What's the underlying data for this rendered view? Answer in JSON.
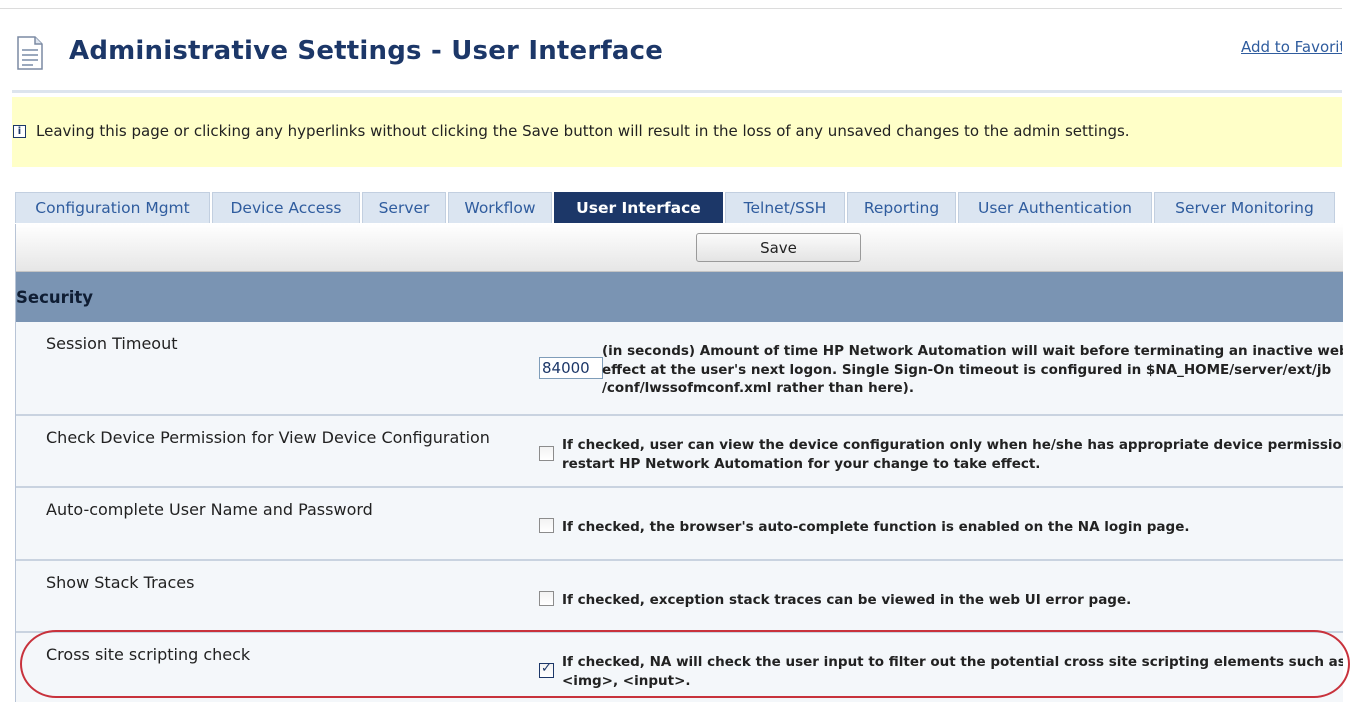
{
  "header": {
    "title": "Administrative Settings - User Interface",
    "favorites_link": "Add to Favorites"
  },
  "notice": {
    "icon": "info-icon",
    "text": "Leaving this page or clicking any hyperlinks without clicking the Save button will result in the loss of any unsaved changes to the admin settings."
  },
  "tabs": [
    {
      "label": "Configuration Mgmt"
    },
    {
      "label": "Device Access"
    },
    {
      "label": "Server"
    },
    {
      "label": "Workflow"
    },
    {
      "label": "User Interface",
      "active": true
    },
    {
      "label": "Telnet/SSH"
    },
    {
      "label": "Reporting"
    },
    {
      "label": "User Authentication"
    },
    {
      "label": "Server Monitoring"
    }
  ],
  "toolbar": {
    "save_label": "Save"
  },
  "section": {
    "title": "Security"
  },
  "settings": [
    {
      "label": "Session Timeout",
      "value": "84000",
      "desc": [
        "(in seconds) Amount of time HP Network Automation will wait before terminating an inactive web",
        "effect at the user's next logon. Single Sign-On timeout is configured in $NA_HOME/server/ext/jb",
        "/conf/lwssofmconf.xml rather than here)."
      ]
    },
    {
      "label": "Check Device Permission for View Device Configuration",
      "checked": false,
      "desc": [
        "If checked, user can view the device configuration only when he/she has appropriate device permission",
        "restart HP Network Automation for your change to take effect."
      ]
    },
    {
      "label": "Auto-complete User Name and Password",
      "checked": false,
      "desc": [
        "If checked, the browser's auto-complete function is enabled on the NA login page."
      ]
    },
    {
      "label": "Show Stack Traces",
      "checked": false,
      "desc": [
        "If checked, exception stack traces can be viewed in the web UI error page."
      ]
    },
    {
      "label": "Cross site scripting check",
      "checked": true,
      "desc": [
        "If checked, NA will check the user input to filter out the potential cross site scripting elements such as",
        "<img>, <input>."
      ]
    }
  ],
  "colors": {
    "title": "#1c3768",
    "notice_bg": "#ffffc8",
    "active_tab": "#1c3768",
    "section_header": "#7a94b3",
    "highlight": "#c8323c"
  }
}
